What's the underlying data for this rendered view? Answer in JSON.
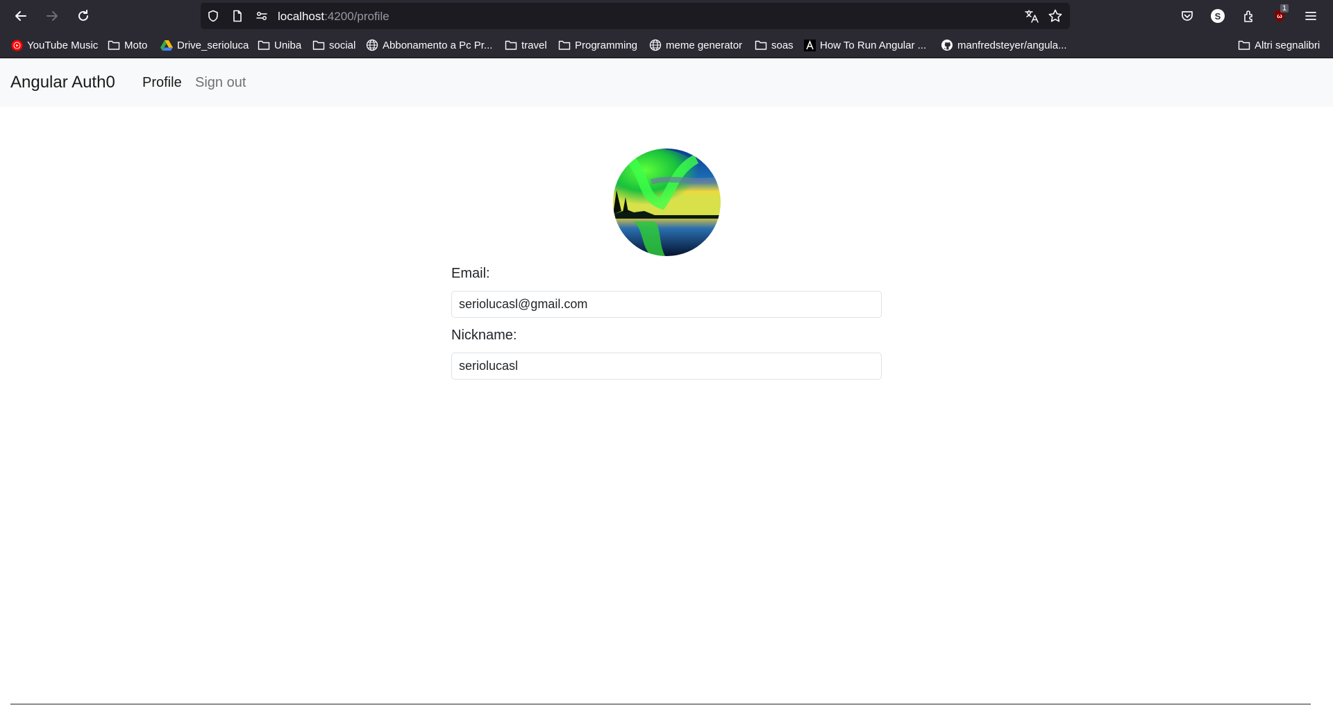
{
  "browser": {
    "url_host": "localhost",
    "url_path": ":4200/profile",
    "notification_count": "1",
    "account_initial": "S"
  },
  "bookmarks": {
    "items": [
      {
        "label": "YouTube Music"
      },
      {
        "label": "Moto"
      },
      {
        "label": "Drive_serioluca"
      },
      {
        "label": "Uniba"
      },
      {
        "label": "social"
      },
      {
        "label": "Abbonamento a Pc Pr..."
      },
      {
        "label": "travel"
      },
      {
        "label": "Programming"
      },
      {
        "label": "meme generator"
      },
      {
        "label": "soas"
      },
      {
        "label": "How To Run Angular ..."
      },
      {
        "label": "manfredsteyer/angula..."
      }
    ],
    "other": "Altri segnalibri"
  },
  "app": {
    "brand": "Angular Auth0",
    "nav": {
      "profile": "Profile",
      "signout": "Sign out"
    }
  },
  "profile": {
    "email_label": "Email:",
    "email_value": "seriolucasl@gmail.com",
    "nickname_label": "Nickname:",
    "nickname_value": "seriolucasl"
  }
}
